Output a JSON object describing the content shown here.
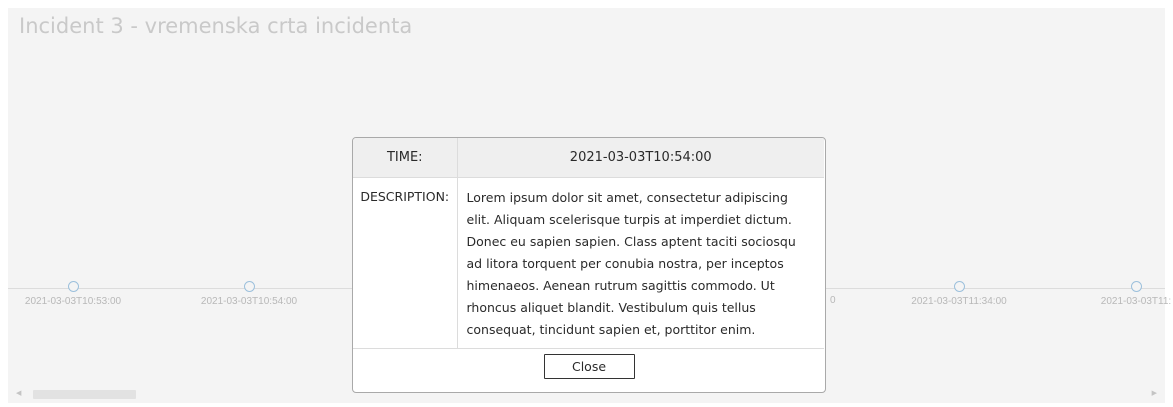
{
  "page": {
    "title": "Incident 3 - vremenska crta incidenta"
  },
  "timeline": {
    "items": [
      {
        "time": "2021-03-03T10:53:00"
      },
      {
        "time": "2021-03-03T10:54:00"
      },
      {
        "time": "2021-03-03T11:34:00"
      },
      {
        "time": "2021-03-03T11:"
      }
    ],
    "partial_right_label": "0",
    "scroll_left_icon": "triangle-left",
    "scroll_right_icon": "triangle-right"
  },
  "modal": {
    "time_label": "TIME:",
    "time_value": "2021-03-03T10:54:00",
    "description_label": "DESCRIPTION:",
    "description_value": "Lorem ipsum dolor sit amet, consectetur adipiscing elit. Aliquam scelerisque turpis at imperdiet dictum. Donec eu sapien sapien. Class aptent taciti sociosqu ad litora torquent per conubia nostra, per inceptos himenaeos. Aenean rutrum sagittis commodo. Ut rhoncus aliquet blandit. Vestibulum quis tellus consequat, tincidunt sapien et, porttitor enim.",
    "close_label": "Close"
  },
  "colors": {
    "panel_background": "#f4f4f4",
    "title_text": "#c9c9c9",
    "timeline_dot": "#9cc0dc",
    "timeline_label": "#b8b8b8",
    "modal_header": "#efefef",
    "modal_border": "#a9a9a9"
  }
}
